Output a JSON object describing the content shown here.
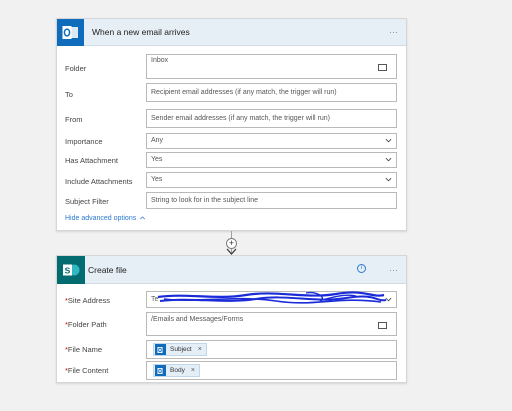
{
  "trigger": {
    "title": "When a new email arrives",
    "menu": "···",
    "icon": "outlook-icon",
    "fields": {
      "folder": {
        "label": "Folder",
        "value": "Inbox"
      },
      "to": {
        "label": "To",
        "placeholder": "Recipient email addresses (if any match, the trigger will run)"
      },
      "from": {
        "label": "From",
        "placeholder": "Sender email addresses (if any match, the trigger will run)"
      },
      "importance": {
        "label": "Importance",
        "value": "Any"
      },
      "has_attachment": {
        "label": "Has Attachment",
        "value": "Yes"
      },
      "include_attachments": {
        "label": "Include Attachments",
        "value": "Yes"
      },
      "subject_filter": {
        "label": "Subject Filter",
        "placeholder": "String to look for in the subject line"
      }
    },
    "advanced_link": "Hide advanced options"
  },
  "connector": {
    "plus": "+"
  },
  "action": {
    "title": "Create file",
    "menu": "···",
    "info": "i",
    "icon": "sharepoint-icon",
    "fields": {
      "site_address": {
        "label": "Site Address",
        "value": "Te"
      },
      "folder_path": {
        "label": "Folder Path",
        "value": "/Emails and Messages/Forms"
      },
      "file_name": {
        "label": "File Name",
        "token": "Subject",
        "remove": "×"
      },
      "file_content": {
        "label": "File Content",
        "token": "Body",
        "remove": "×"
      }
    },
    "required_marker": "*"
  },
  "colors": {
    "header_bg": "#e6eef6",
    "outlook_blue": "#0f6cbd",
    "sharepoint_teal": "#036c70",
    "link_blue": "#2b79d0",
    "required_red": "#cc0000",
    "scribble_blue": "#1a2bd8"
  }
}
